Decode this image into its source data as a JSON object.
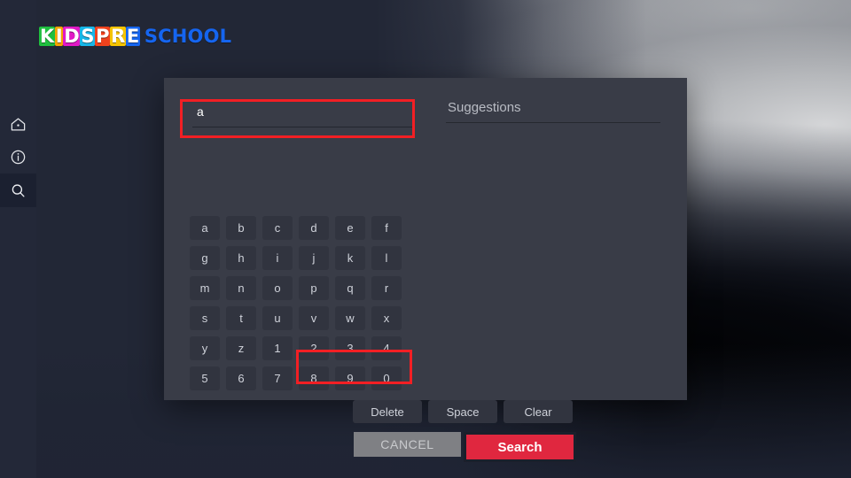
{
  "brand": {
    "letters": [
      {
        "char": "K",
        "color": "#1fbf3f"
      },
      {
        "char": "I",
        "color": "#f5a400"
      },
      {
        "char": "D",
        "color": "#e119c6"
      },
      {
        "char": "S",
        "color": "#17b6e8"
      },
      {
        "char": "P",
        "color": "#f0421d"
      },
      {
        "char": "R",
        "color": "#f5c400"
      },
      {
        "char": "E",
        "color": "#1565f0"
      }
    ],
    "word2": "SCHOOL",
    "word2_color": "#1565f0"
  },
  "sidebar": {
    "items": [
      {
        "name": "home",
        "icon": "home-icon",
        "active": false
      },
      {
        "name": "info",
        "icon": "info-icon",
        "active": false
      },
      {
        "name": "search",
        "icon": "search-icon",
        "active": true
      }
    ]
  },
  "dialog": {
    "search_field": {
      "value": "a",
      "placeholder": ""
    },
    "keyboard": {
      "keys": [
        "a",
        "b",
        "c",
        "d",
        "e",
        "f",
        "g",
        "h",
        "i",
        "j",
        "k",
        "l",
        "m",
        "n",
        "o",
        "p",
        "q",
        "r",
        "s",
        "t",
        "u",
        "v",
        "w",
        "x",
        "y",
        "z",
        "1",
        "2",
        "3",
        "4",
        "5",
        "6",
        "7",
        "8",
        "9",
        "0"
      ],
      "wide_keys": [
        "Delete",
        "Space",
        "Clear"
      ]
    },
    "actions": {
      "cancel_label": "CANCEL",
      "search_label": "Search"
    },
    "suggestions": {
      "title": "Suggestions",
      "items": []
    }
  },
  "colors": {
    "accent_red": "#e0273f",
    "highlight_red": "#f21f24",
    "dialog_bg": "#393c47",
    "key_bg": "#31343f",
    "rail_bg": "#232838",
    "cancel_bg": "#7f8084"
  }
}
